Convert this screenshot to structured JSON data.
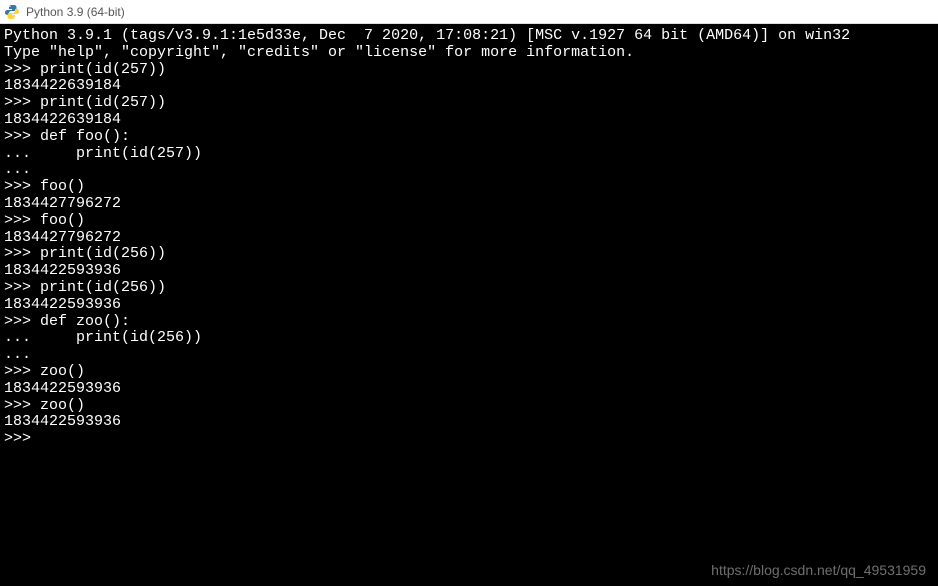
{
  "window": {
    "title": "Python 3.9 (64-bit)",
    "icon_name": "python-icon"
  },
  "terminal": {
    "lines": [
      "Python 3.9.1 (tags/v3.9.1:1e5d33e, Dec  7 2020, 17:08:21) [MSC v.1927 64 bit (AMD64)] on win32",
      "Type \"help\", \"copyright\", \"credits\" or \"license\" for more information.",
      ">>> print(id(257))",
      "1834422639184",
      ">>> print(id(257))",
      "1834422639184",
      ">>> def foo():",
      "...     print(id(257))",
      "...",
      ">>> foo()",
      "1834427796272",
      ">>> foo()",
      "1834427796272",
      ">>> print(id(256))",
      "1834422593936",
      ">>> print(id(256))",
      "1834422593936",
      ">>> def zoo():",
      "...     print(id(256))",
      "...",
      ">>> zoo()",
      "1834422593936",
      ">>> zoo()",
      "1834422593936",
      ">>>"
    ]
  },
  "watermark": {
    "text": "https://blog.csdn.net/qq_49531959"
  }
}
